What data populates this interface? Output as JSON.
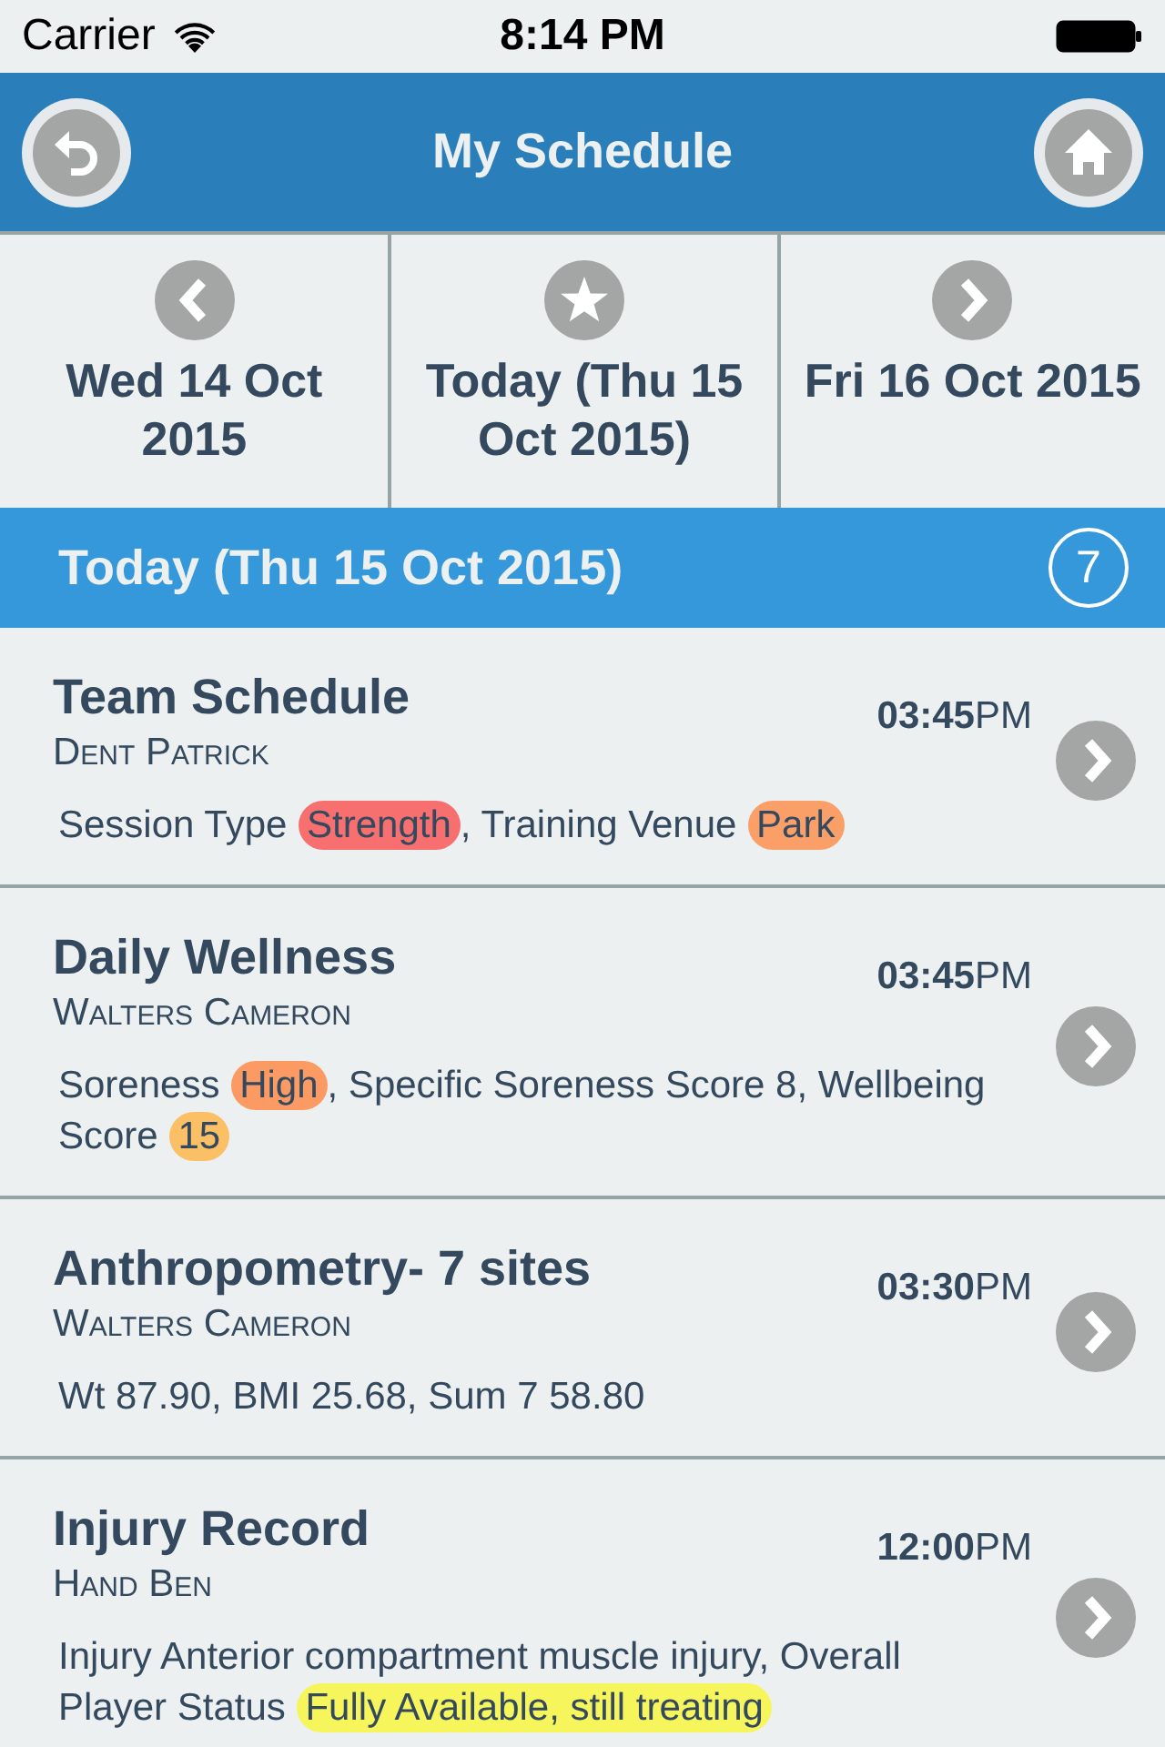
{
  "status_bar": {
    "carrier": "Carrier",
    "time": "8:14 PM"
  },
  "header": {
    "title": "My Schedule"
  },
  "day_nav": [
    {
      "kind": "previous",
      "label": "Wed 14 Oct 2015"
    },
    {
      "kind": "today",
      "label": "Today (Thu 15 Oct 2015)"
    },
    {
      "kind": "next",
      "label": "Fri 16 Oct 2015"
    }
  ],
  "section": {
    "title": "Today (Thu 15 Oct 2015)",
    "count": "7"
  },
  "entries": [
    {
      "title": "Team Schedule",
      "person": "Dent Patrick",
      "time": "**03:45**PM",
      "details": [
        {
          "text": "Session Type "
        },
        {
          "text": "Strength",
          "color": "#f76f6f"
        },
        {
          "text": ", Training Venue "
        },
        {
          "text": "Park",
          "color": "#fb9f68"
        }
      ]
    },
    {
      "title": "Daily Wellness",
      "person": "Walters Cameron",
      "time": "**03:45**PM",
      "details": [
        {
          "text": "Soreness "
        },
        {
          "text": "High",
          "color": "#fb9a63"
        },
        {
          "text": ", Specific Soreness Score 8, Wellbeing "
        },
        {
          "text": "Score "
        },
        {
          "text": "15",
          "color": "#fbbf66"
        }
      ]
    },
    {
      "title": "Anthropometry- 7 sites",
      "person": "Walters Cameron",
      "time": "**03:30**PM",
      "details": [
        {
          "text": "Wt 87.90, BMI 25.68, Sum 7 58.80"
        }
      ]
    },
    {
      "title": "Injury Record",
      "person": "Hand Ben",
      "time": "**12:00**PM",
      "details": [
        {
          "text": "Injury Anterior compartment muscle injury, Overall "
        },
        {
          "text": "Player Status "
        },
        {
          "text": "Fully Available, still treating",
          "color": "#f6f65c"
        }
      ]
    }
  ]
}
